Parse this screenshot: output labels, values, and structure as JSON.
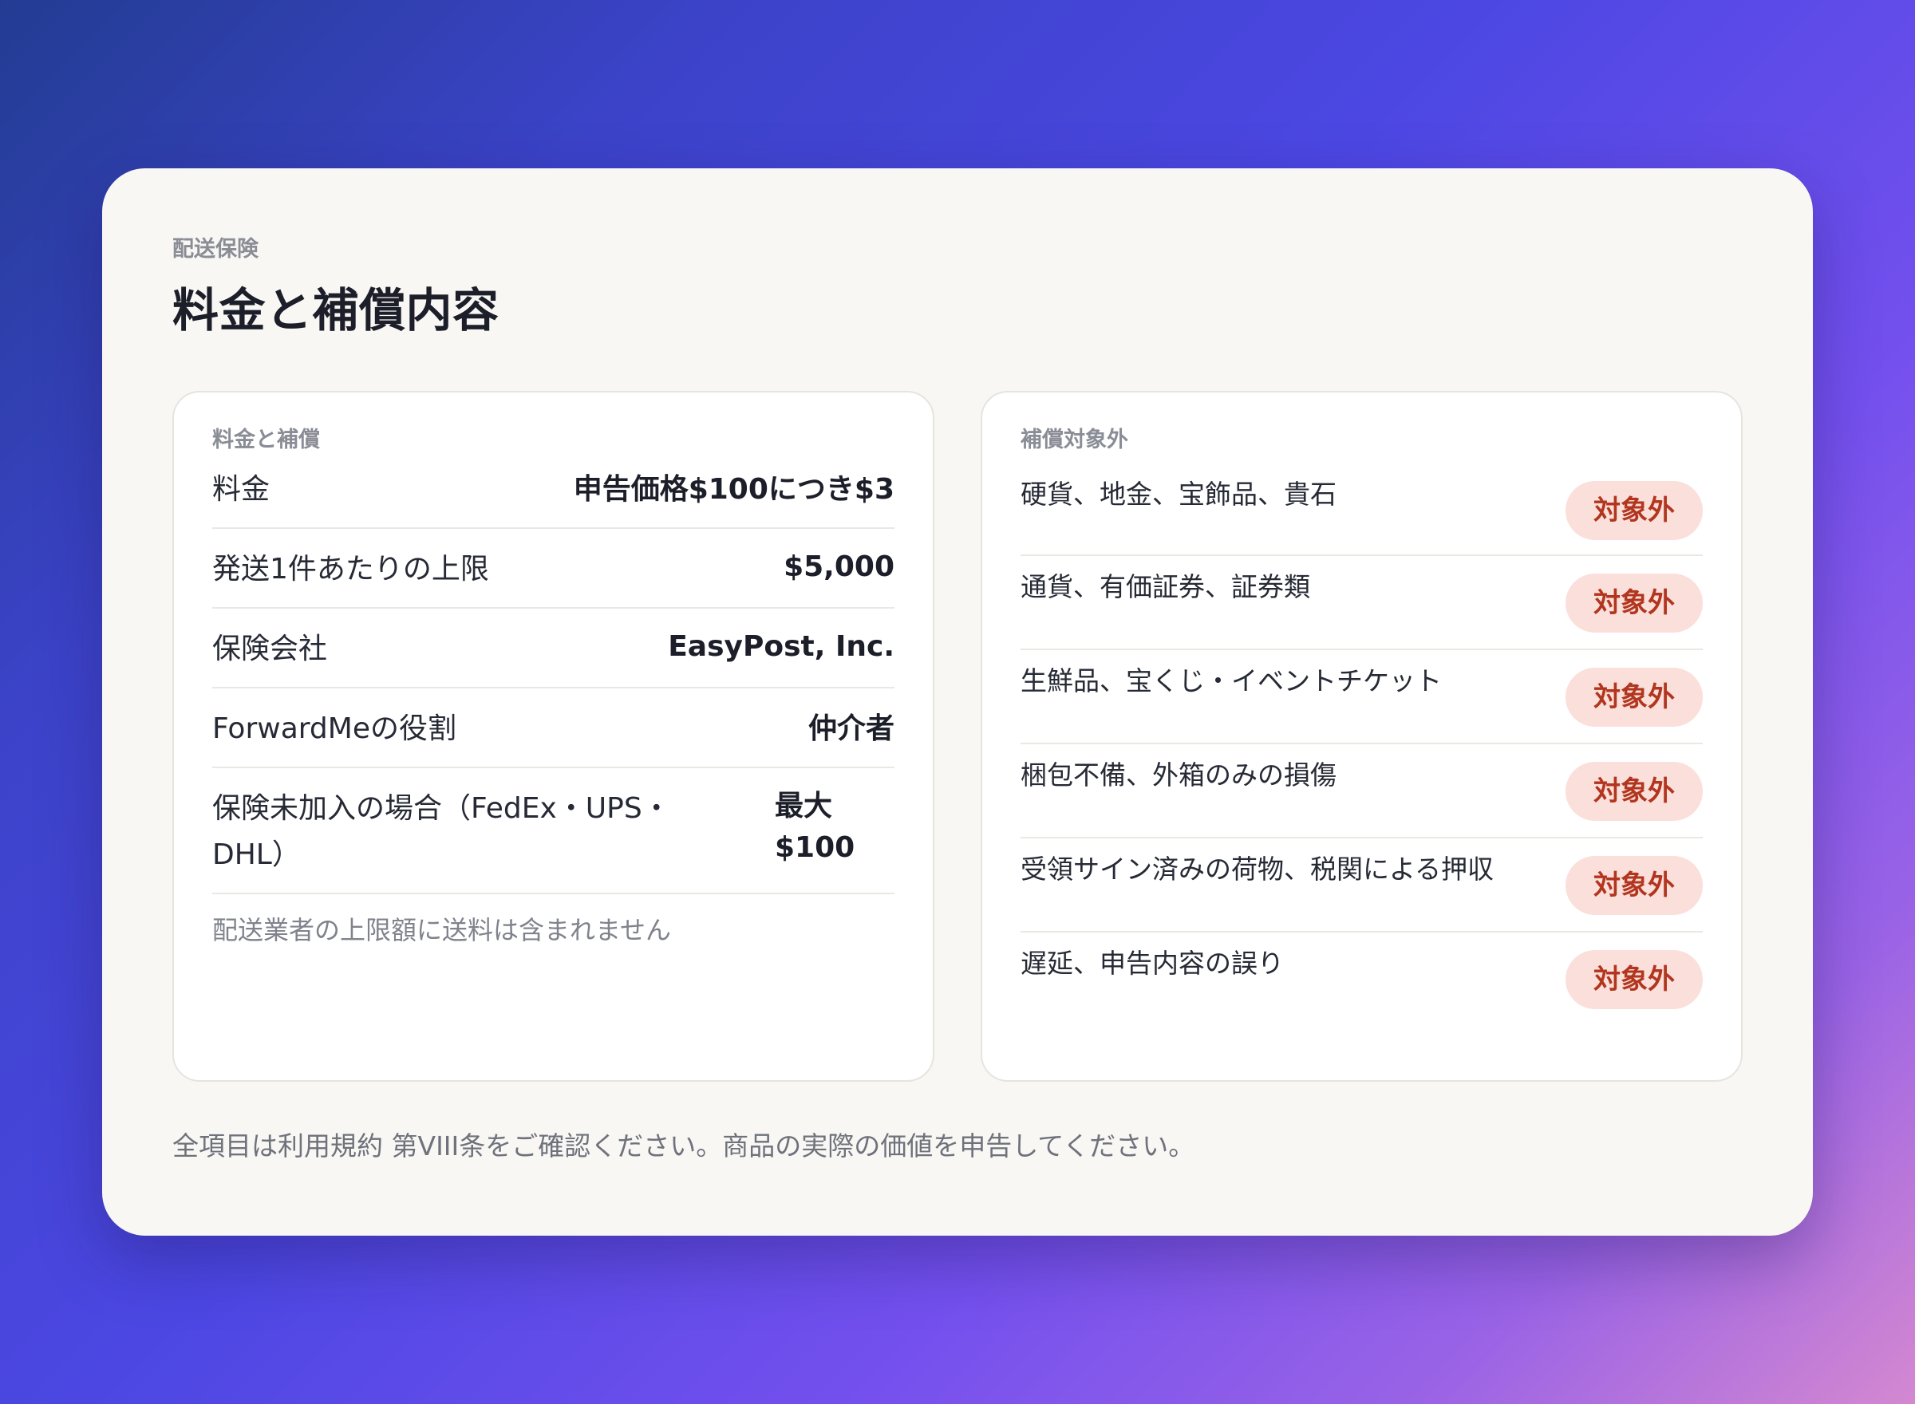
{
  "header": {
    "eyebrow": "配送保険",
    "title": "料金と補償内容"
  },
  "coverage": {
    "label": "料金と補償",
    "rows": [
      {
        "key": "料金",
        "value": "申告価格$100につき$3"
      },
      {
        "key": "発送1件あたりの上限",
        "value": "$5,000"
      },
      {
        "key": "保険会社",
        "value": "EasyPost, Inc."
      },
      {
        "key": "ForwardMeの役割",
        "value": "仲介者"
      },
      {
        "key": "保険未加入の場合（FedEx・UPS・DHL）",
        "value": "最大 $100"
      }
    ],
    "note": "配送業者の上限額に送料は含まれません"
  },
  "exclusions": {
    "label": "補償対象外",
    "badge_label": "対象外",
    "items": [
      {
        "text": "硬貨、地金、宝飾品、貴石",
        "badge": "対象外"
      },
      {
        "text": "通貨、有価証券、証券類",
        "badge": "対象外"
      },
      {
        "text": "生鮮品、宝くじ・イベントチケット",
        "badge": "対象外"
      },
      {
        "text": "梱包不備、外箱のみの損傷",
        "badge": "対象外"
      },
      {
        "text": "受領サイン済みの荷物、税関による押収",
        "badge": "対象外"
      },
      {
        "text": "遅延、申告内容の誤り",
        "badge": "対象外"
      }
    ]
  },
  "footer": {
    "text": "全項目は利用規約 第VIII条をご確認ください。商品の実際の価値を申告してください。"
  },
  "colors": {
    "card_bg": "#f8f7f4",
    "badge_bg": "#fadfda",
    "badge_text": "#b2361f"
  }
}
